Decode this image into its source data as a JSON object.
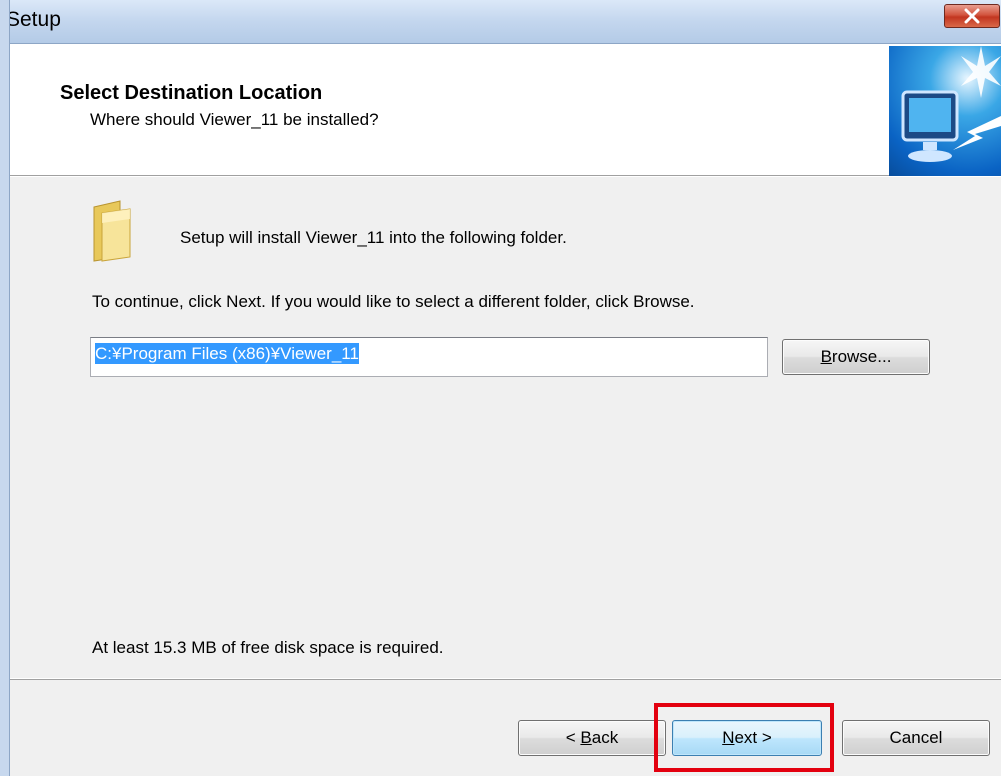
{
  "window": {
    "title": "Setup",
    "close_icon": "close-x-icon",
    "close_color": "#c23620"
  },
  "header": {
    "title": "Select Destination Location",
    "subtitle": "Where should Viewer_11 be installed?",
    "image_icon": "monitor-install-icon"
  },
  "body": {
    "folder_icon": "folder-icon",
    "intro": "Setup will install Viewer_11 into the following folder.",
    "continue_text": "To continue, click Next. If you would like to select a different folder, click Browse.",
    "path_value": "C:¥Program Files (x86)¥Viewer_11",
    "browse_label_pre": "B",
    "browse_label_rest": "rowse...",
    "space_text": "At least 15.3 MB of free disk space is required."
  },
  "footer": {
    "back_label_pre": "< ",
    "back_label_key": "B",
    "back_label_rest": "ack",
    "next_label_key": "N",
    "next_label_rest": "ext >",
    "cancel_label": "Cancel",
    "highlight_color": "#e3000f"
  }
}
